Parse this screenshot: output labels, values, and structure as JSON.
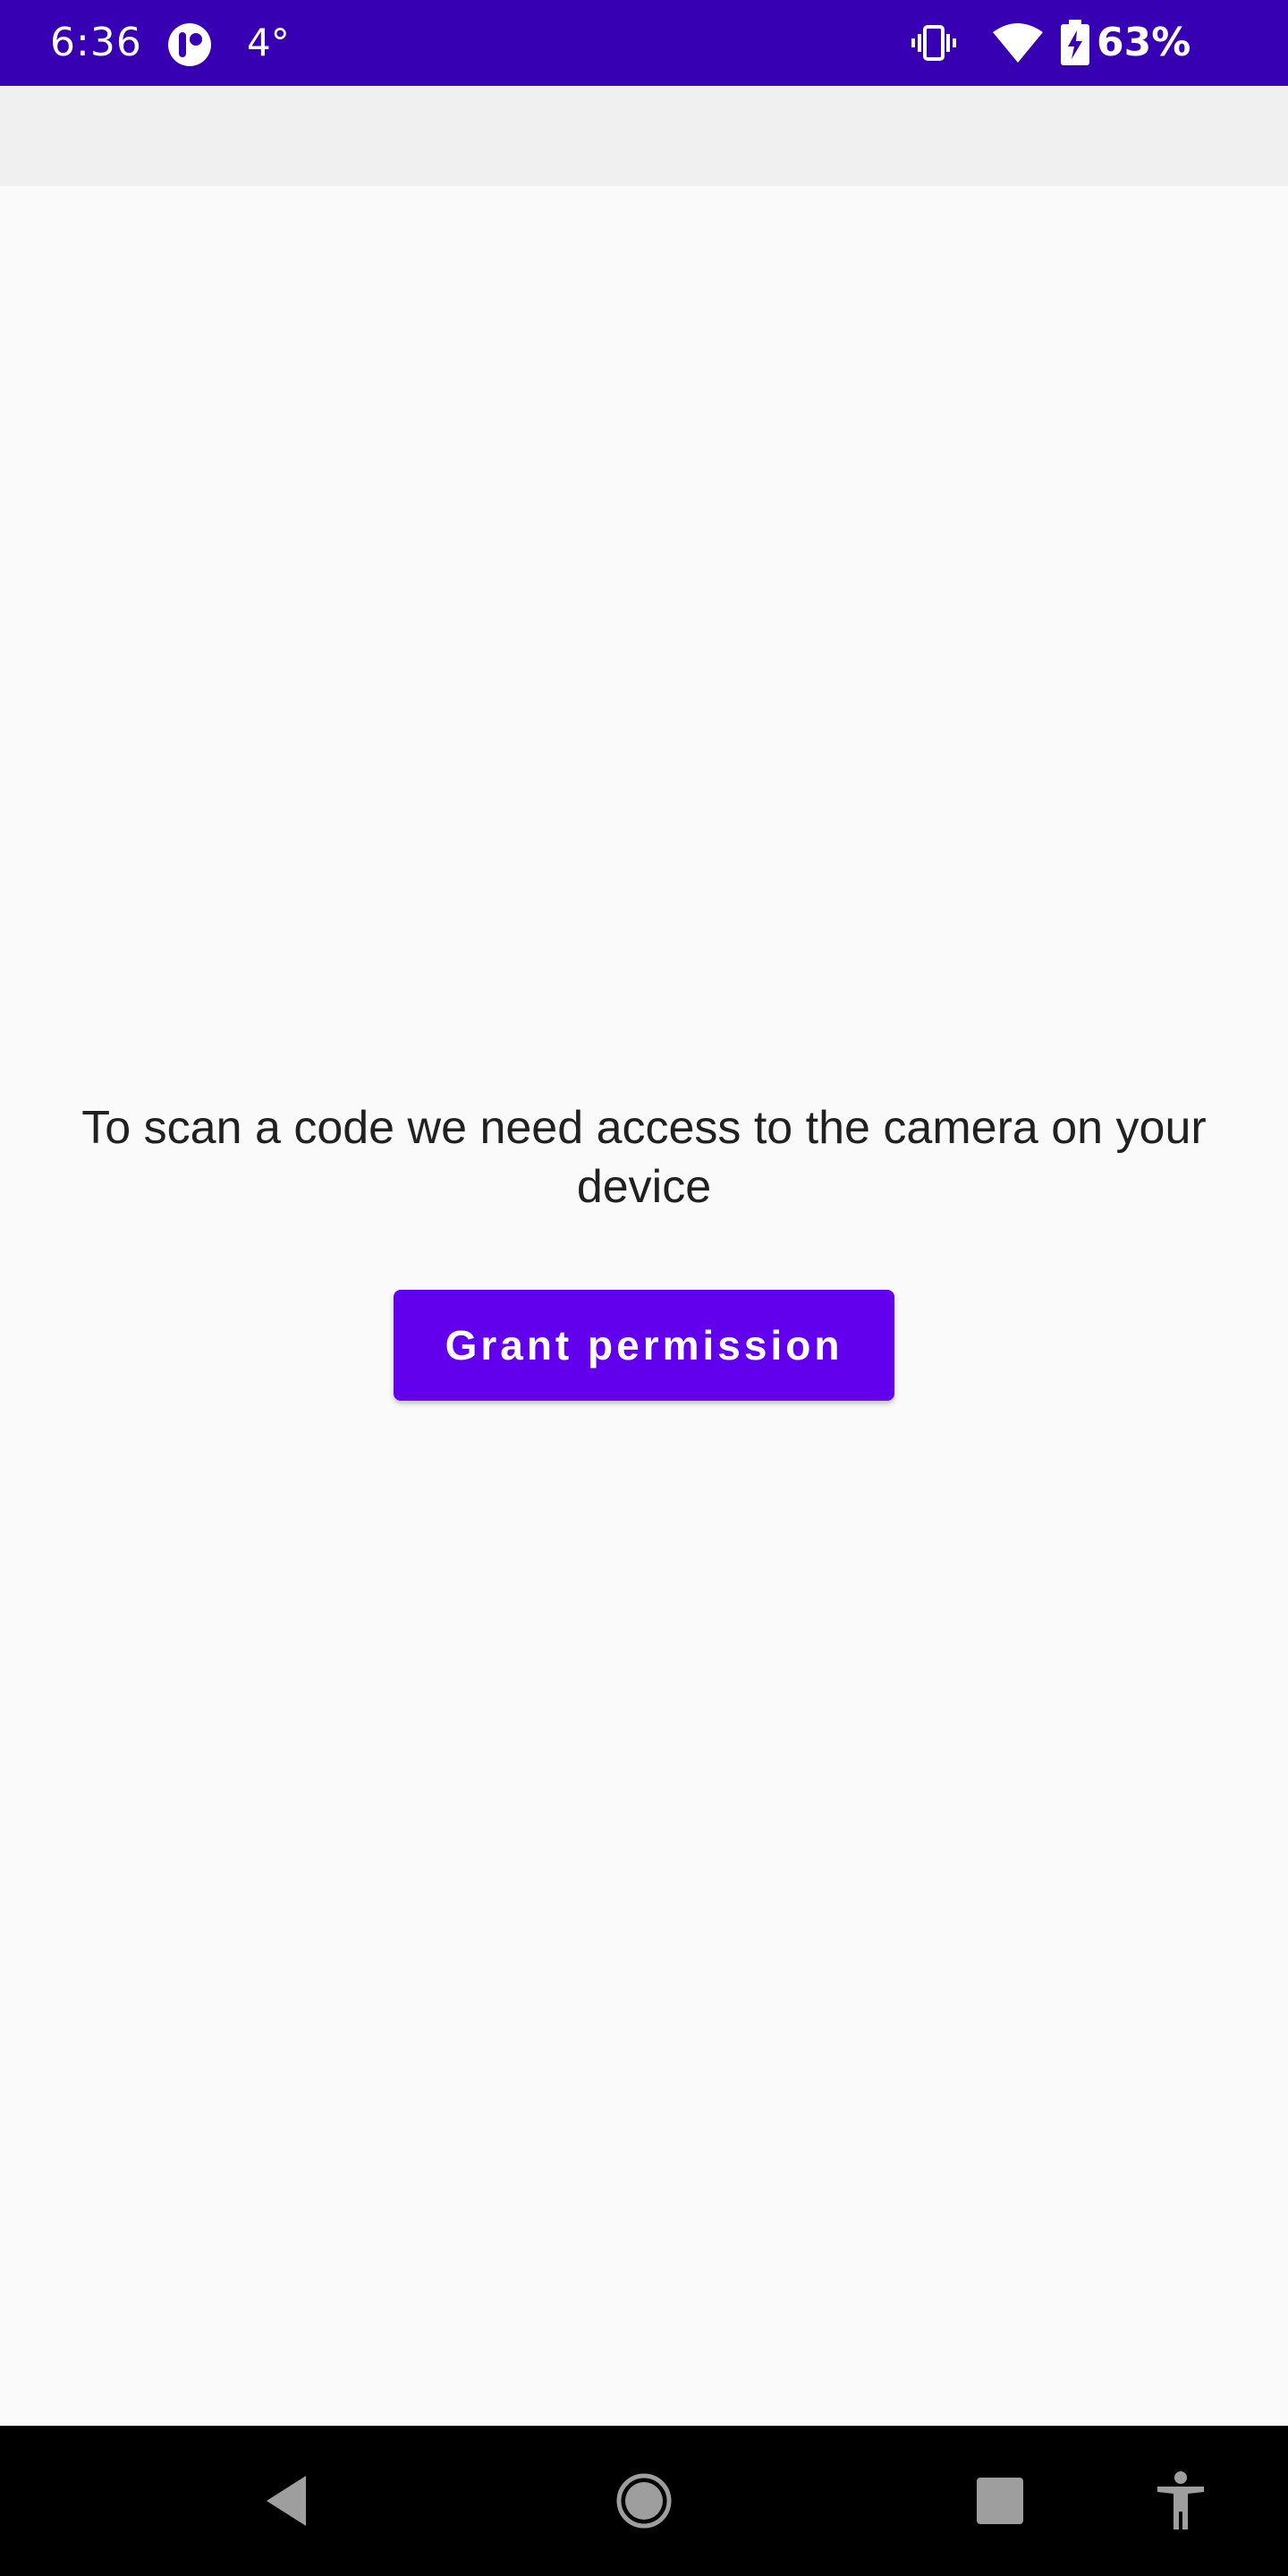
{
  "status_bar": {
    "time": "6:36",
    "temperature": "4°",
    "battery": "63%",
    "icons": [
      "app-notification-icon",
      "vibrate-icon",
      "wifi-icon",
      "battery-charging-icon"
    ],
    "background_color": "#3700b3"
  },
  "main": {
    "message": "To scan a code we need access to the camera on your device",
    "grant_button_label": "Grant permission",
    "accent_color": "#6200ee"
  },
  "nav_bar": {
    "buttons": [
      "back-icon",
      "home-icon",
      "recents-icon",
      "accessibility-icon"
    ]
  }
}
